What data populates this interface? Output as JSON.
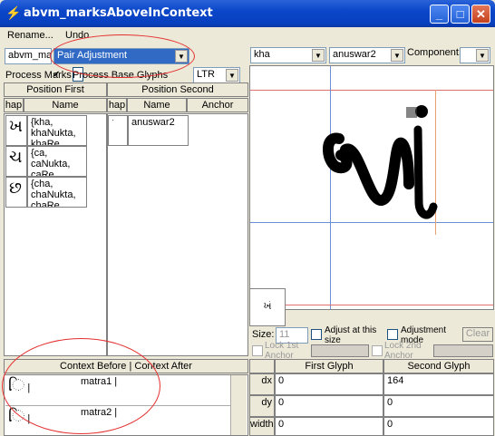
{
  "window": {
    "title": "abvm_marksAboveInContext",
    "icon": "lightning-app-icon",
    "minimize": "_",
    "maximize": "□",
    "close": "✕"
  },
  "menu": {
    "rename": "Rename...",
    "undo": "Undo"
  },
  "toolbar": {
    "lookup_combo": "abvm_mar",
    "type_combo": "Pair Adjustment",
    "process_marks": "Process Marks",
    "process_base": "Process Base Glyphs",
    "direction": "LTR",
    "first_glyph_combo": "kha",
    "second_glyph_combo": "anuswar2",
    "component_label": "Component:",
    "component_combo": ""
  },
  "left_panel": {
    "position_first": "Position First",
    "position_second": "Position Second",
    "col_shape": "hap",
    "col_name": "Name",
    "col_shape2": "hap",
    "col_name2": "Name",
    "col_anchor": "Anchor",
    "first_rows": [
      {
        "glyph": "ખ",
        "name": "{kha, khaNukta, khaRe"
      },
      {
        "glyph": "ચ",
        "name": "{ca, caNukta, caRe"
      },
      {
        "glyph": "છ",
        "name": "{cha, chaNukta, chaRe"
      }
    ],
    "second_rows": [
      {
        "glyph": "ˑ",
        "name": "anuswar2",
        "anchor": ""
      }
    ]
  },
  "preview": {
    "glyph": "ખં",
    "thumb_glyph": "ખં",
    "size_label": "Size:",
    "size_value": "11",
    "adjust_size": "Adjust at this size",
    "adjustment_mode": "Adjustment mode",
    "lock_first_anchor": "Lock 1st Anchor",
    "lock_second_anchor": "Lock 2nd Anchor",
    "clear": "Clear"
  },
  "context": {
    "header": "Context Before | Context After",
    "rows": [
      {
        "glyph": "િ",
        "sep": "|",
        "name": "matra1 |"
      },
      {
        "glyph": "િ",
        "sep": "|",
        "name": "matra2 |"
      }
    ]
  },
  "adjust_table": {
    "first_glyph": "First Glyph",
    "second_glyph": "Second Glyph",
    "rows": [
      {
        "label": "dx",
        "first": "0",
        "second": "164"
      },
      {
        "label": "dy",
        "first": "0",
        "second": "0"
      },
      {
        "label": "width",
        "first": "0",
        "second": "0"
      }
    ]
  },
  "colors": {
    "title_bar": "#0a46c9",
    "annotation": "#e53030",
    "guide_red": "#e07070",
    "guide_blue": "#6a8fd6",
    "selection": "#316ac5"
  }
}
